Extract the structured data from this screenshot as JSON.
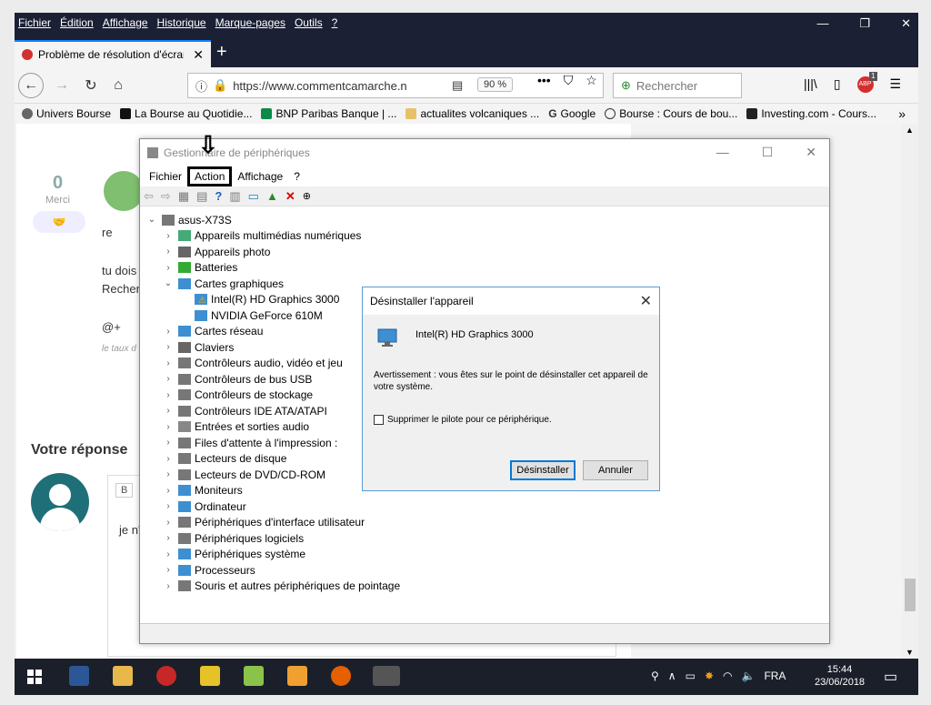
{
  "browser": {
    "menu": [
      "Fichier",
      "Édition",
      "Affichage",
      "Historique",
      "Marque-pages",
      "Outils",
      "?"
    ],
    "tab_title": "Problème de résolution d'écran",
    "url": "https://www.commentcamarche.n",
    "zoom": "90 %",
    "search_placeholder": "Rechercher",
    "bookmarks": [
      "Univers Bourse",
      "La Bourse au Quotidie...",
      "BNP Paribas Banque | ...",
      "actualites volcaniques ...",
      "Google",
      "Bourse : Cours de bou...",
      "Investing.com - Cours..."
    ],
    "addon_badge": "1",
    "addon_label": "ABP"
  },
  "page": {
    "merci_count": "0",
    "merci_label": "Merci",
    "reply_heading": "Votre réponse",
    "snippets": [
      "re",
      "tu dois",
      "Recher",
      "@+",
      "le taux d",
      "je n'"
    ],
    "bold_btn": "B"
  },
  "devmgr": {
    "title": "Gestionnaire de périphériques",
    "menu": [
      "Fichier",
      "Action",
      "Affichage",
      "?"
    ],
    "root": "asus-X73S",
    "tree": [
      {
        "label": "Appareils multimédias numériques",
        "level": 1,
        "expanded": false
      },
      {
        "label": "Appareils photo",
        "level": 1,
        "expanded": false
      },
      {
        "label": "Batteries",
        "level": 1,
        "expanded": false
      },
      {
        "label": "Cartes graphiques",
        "level": 1,
        "expanded": true
      },
      {
        "label": "Intel(R) HD Graphics 3000",
        "level": 2,
        "warning": true
      },
      {
        "label": "NVIDIA GeForce 610M",
        "level": 2
      },
      {
        "label": "Cartes réseau",
        "level": 1,
        "expanded": false
      },
      {
        "label": "Claviers",
        "level": 1,
        "expanded": false
      },
      {
        "label": "Contrôleurs audio, vidéo et jeu",
        "level": 1,
        "expanded": false
      },
      {
        "label": "Contrôleurs de bus USB",
        "level": 1,
        "expanded": false
      },
      {
        "label": "Contrôleurs de stockage",
        "level": 1,
        "expanded": false
      },
      {
        "label": "Contrôleurs IDE ATA/ATAPI",
        "level": 1,
        "expanded": false
      },
      {
        "label": "Entrées et sorties audio",
        "level": 1,
        "expanded": false
      },
      {
        "label": "Files d'attente à l'impression :",
        "level": 1,
        "expanded": false
      },
      {
        "label": "Lecteurs de disque",
        "level": 1,
        "expanded": false
      },
      {
        "label": "Lecteurs de DVD/CD-ROM",
        "level": 1,
        "expanded": false
      },
      {
        "label": "Moniteurs",
        "level": 1,
        "expanded": false
      },
      {
        "label": "Ordinateur",
        "level": 1,
        "expanded": false
      },
      {
        "label": "Périphériques d'interface utilisateur",
        "level": 1,
        "expanded": false
      },
      {
        "label": "Périphériques logiciels",
        "level": 1,
        "expanded": false
      },
      {
        "label": "Périphériques système",
        "level": 1,
        "expanded": false
      },
      {
        "label": "Processeurs",
        "level": 1,
        "expanded": false
      },
      {
        "label": "Souris et autres périphériques de pointage",
        "level": 1,
        "expanded": false
      }
    ]
  },
  "dialog": {
    "title": "Désinstaller l'appareil",
    "device": "Intel(R) HD Graphics 3000",
    "warning": "Avertissement : vous êtes sur le point de désinstaller cet appareil de votre système.",
    "checkbox_label": "Supprimer le pilote pour ce périphérique.",
    "checkbox_checked": false,
    "btn_uninstall": "Désinstaller",
    "btn_cancel": "Annuler"
  },
  "taskbar": {
    "lang": "FRA",
    "time": "15:44",
    "date": "23/06/2018"
  }
}
